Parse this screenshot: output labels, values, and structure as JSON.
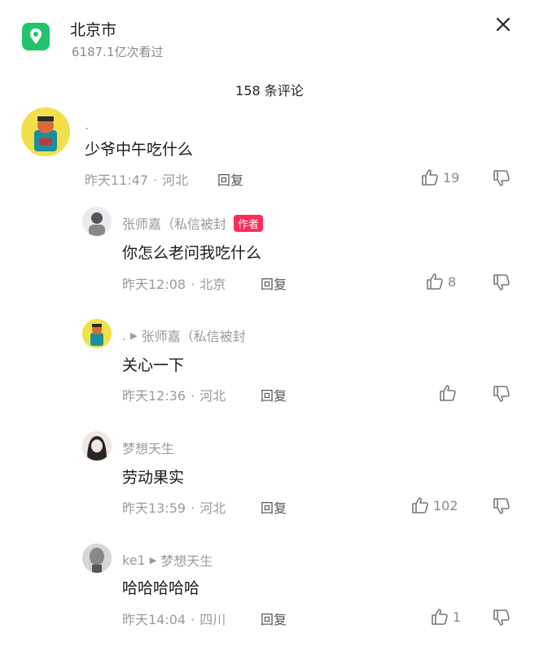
{
  "header": {
    "location_title": "北京市",
    "views": "6187.1亿次看过",
    "location_icon": "location-pin-icon",
    "close_icon": "close-icon"
  },
  "comments_count": "158 条评论",
  "colors": {
    "accent_green": "#22c46a",
    "author_badge": "#fe2c55",
    "muted_text": "#9a9a9a"
  },
  "comments": [
    {
      "username": ".",
      "text": "少爷中午吃什么",
      "time": "昨天11:47",
      "region": "河北",
      "reply_label": "回复",
      "likes": "19"
    },
    {
      "username": "张师嘉（私信被封",
      "author_badge": "作者",
      "text": "你怎么老问我吃什么",
      "time": "昨天12:08",
      "region": "北京",
      "reply_label": "回复",
      "likes": "8"
    },
    {
      "username": ".",
      "reply_to": "张师嘉（私信被封",
      "text": "关心一下",
      "time": "昨天12:36",
      "region": "河北",
      "reply_label": "回复",
      "likes": ""
    },
    {
      "username": "梦想天生",
      "text": "劳动果实",
      "time": "昨天13:59",
      "region": "河北",
      "reply_label": "回复",
      "likes": "102"
    },
    {
      "username": "ke1",
      "reply_to": "梦想天生",
      "text": "哈哈哈哈哈",
      "time": "昨天14:04",
      "region": "四川",
      "reply_label": "回复",
      "likes": "1"
    }
  ]
}
